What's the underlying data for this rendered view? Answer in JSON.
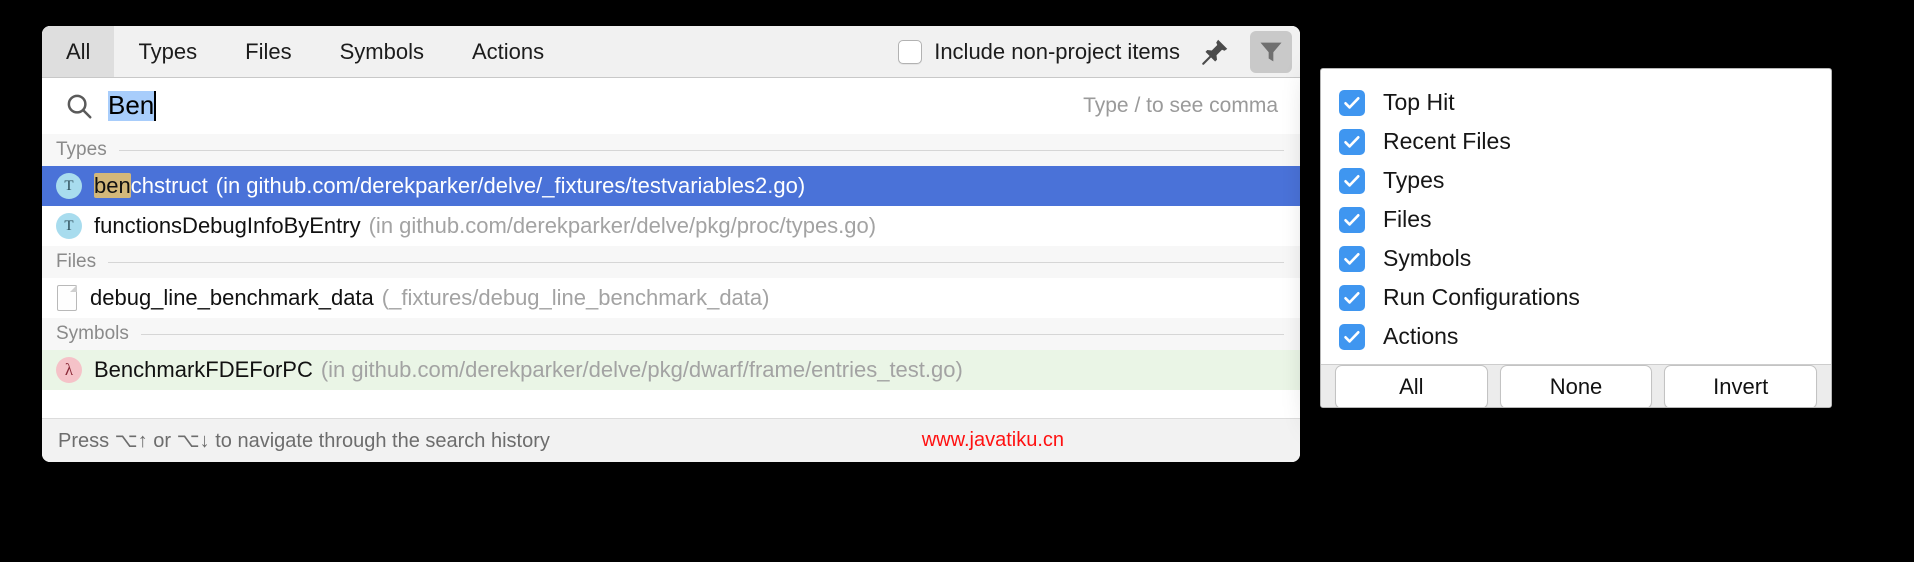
{
  "window": {
    "tabs": [
      {
        "label": "All",
        "active": true
      },
      {
        "label": "Types",
        "active": false
      },
      {
        "label": "Files",
        "active": false
      },
      {
        "label": "Symbols",
        "active": false
      },
      {
        "label": "Actions",
        "active": false
      }
    ],
    "include_non_project": {
      "label": "Include non-project items",
      "checked": false
    },
    "pin_icon": "pin-icon",
    "filter_icon": "filter-funnel-icon"
  },
  "search": {
    "icon": "search-icon",
    "value": "Ben",
    "hint": "Type / to see comma"
  },
  "results": {
    "groups": [
      {
        "title": "Types",
        "rows": [
          {
            "badge": "T",
            "badge_kind": "type",
            "match": "ben",
            "name_rest": "chstruct",
            "path": "(in github.com/derekparker/delve/_fixtures/testvariables2.go)",
            "state": "selected"
          },
          {
            "badge": "T",
            "badge_kind": "type",
            "match": "",
            "name_rest": "functionsDebugInfoByEntry",
            "path": "(in github.com/derekparker/delve/pkg/proc/types.go)",
            "state": "normal"
          }
        ]
      },
      {
        "title": "Files",
        "rows": [
          {
            "badge": "",
            "badge_kind": "file",
            "match": "",
            "name_rest": "debug_line_benchmark_data",
            "path": "(_fixtures/debug_line_benchmark_data)",
            "state": "normal"
          }
        ]
      },
      {
        "title": "Symbols",
        "rows": [
          {
            "badge": "λ",
            "badge_kind": "lambda",
            "match": "",
            "name_rest": "BenchmarkFDEForPC",
            "path": "(in github.com/derekparker/delve/pkg/dwarf/frame/entries_test.go)",
            "state": "greenish"
          }
        ]
      }
    ]
  },
  "footer": {
    "hint": "Press ⌥↑ or ⌥↓ to navigate through the search history",
    "watermark": "www.javatiku.cn"
  },
  "filter_popup": {
    "items": [
      {
        "label": "Top Hit",
        "checked": true
      },
      {
        "label": "Recent Files",
        "checked": true
      },
      {
        "label": "Types",
        "checked": true
      },
      {
        "label": "Files",
        "checked": true
      },
      {
        "label": "Symbols",
        "checked": true
      },
      {
        "label": "Run Configurations",
        "checked": true
      },
      {
        "label": "Actions",
        "checked": true
      }
    ],
    "buttons": [
      {
        "label": "All"
      },
      {
        "label": "None"
      },
      {
        "label": "Invert"
      }
    ]
  },
  "colors": {
    "selection_blue": "#4a72d8",
    "match_highlight": "#d3b87a",
    "checkbox_blue": "#3f96f0",
    "symbol_row_green": "#eaf5e6",
    "watermark_red": "#ff1111"
  }
}
